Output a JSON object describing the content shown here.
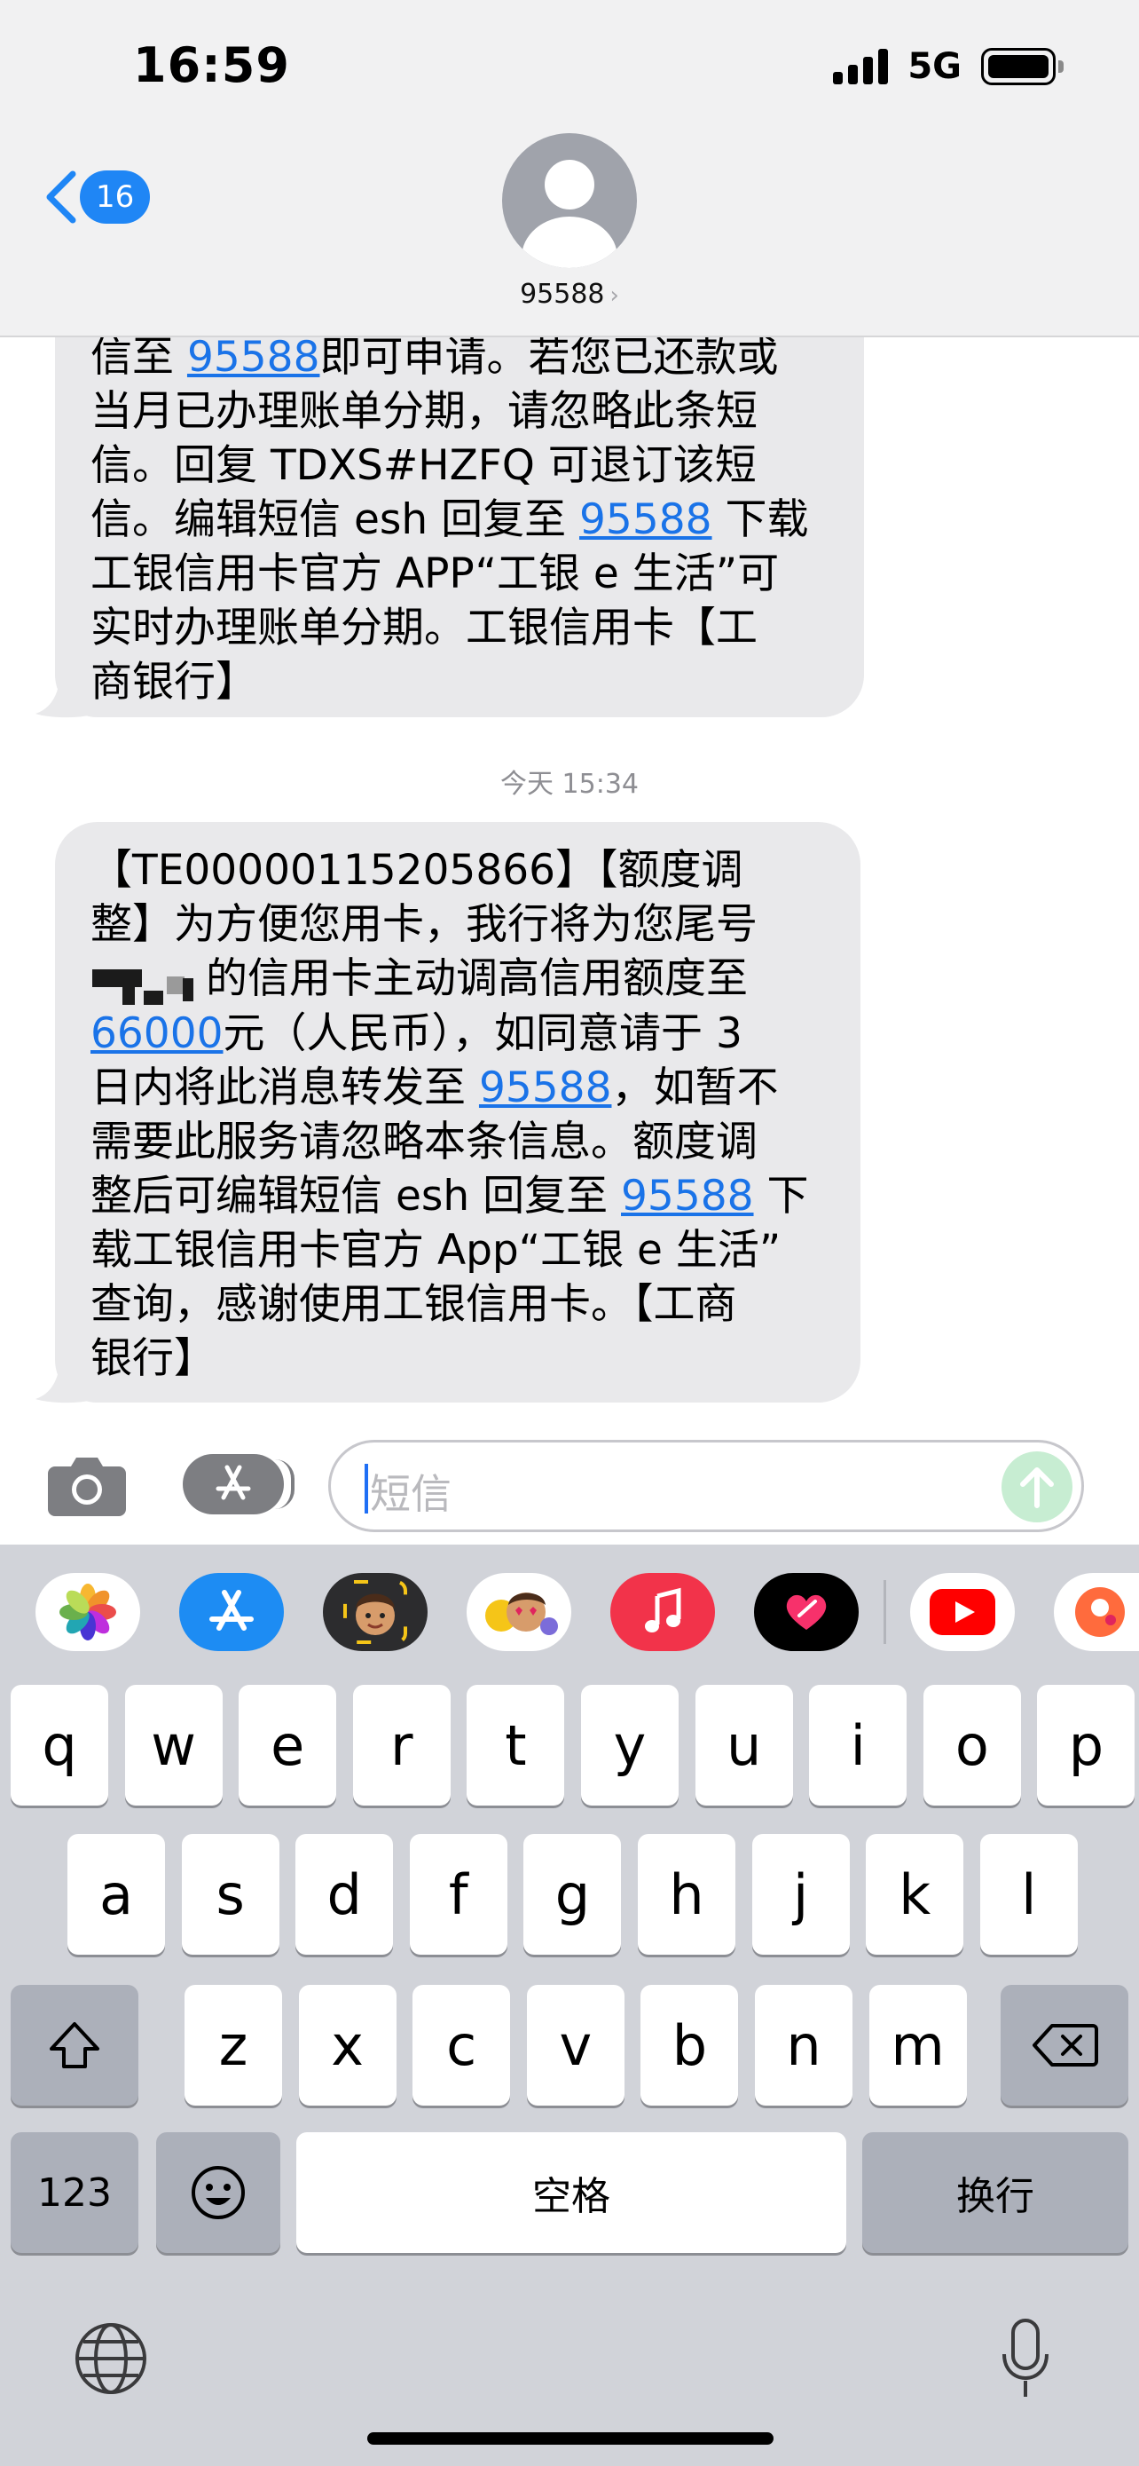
{
  "status_bar": {
    "time": "16:59",
    "network": "5G"
  },
  "header": {
    "back_count": "16",
    "contact_name": "95588",
    "contact_chevron": "›"
  },
  "messages": [
    {
      "lines": [
        {
          "segments": [
            {
              "text": "信至 "
            },
            {
              "text": "95588",
              "link": true
            },
            {
              "text": "即可申请。若您已还款或"
            }
          ]
        },
        {
          "segments": [
            {
              "text": "当月已办理账单分期，请忽略此条短"
            }
          ]
        },
        {
          "segments": [
            {
              "text": "信。回复 TDXS#HZFQ 可退订该短"
            }
          ]
        },
        {
          "segments": [
            {
              "text": "信。编辑短信 esh 回复至 "
            },
            {
              "text": "95588",
              "link": true
            },
            {
              "text": " 下载"
            }
          ]
        },
        {
          "segments": [
            {
              "text": "工银信用卡官方 APP“工银 e 生活”可"
            }
          ]
        },
        {
          "segments": [
            {
              "text": "实时办理账单分期。工银信用卡【工"
            }
          ]
        },
        {
          "segments": [
            {
              "text": "商银行】"
            }
          ]
        }
      ]
    },
    {
      "lines": [
        {
          "segments": [
            {
              "text": "【TE00000115205866】【额度调"
            }
          ]
        },
        {
          "segments": [
            {
              "text": "整】为方便您用卡，我行将为您尾号"
            }
          ]
        },
        {
          "segments": [
            {
              "redacted": true
            },
            {
              "text": "的信用卡主动调高信用额度至"
            }
          ]
        },
        {
          "segments": [
            {
              "text": "66000",
              "link": true
            },
            {
              "text": "元（人民币），如同意请于 3"
            }
          ]
        },
        {
          "segments": [
            {
              "text": "日内将此消息转发至 "
            },
            {
              "text": "95588",
              "link": true
            },
            {
              "text": "，如暂不"
            }
          ]
        },
        {
          "segments": [
            {
              "text": "需要此服务请忽略本条信息。额度调"
            }
          ]
        },
        {
          "segments": [
            {
              "text": "整后可编辑短信 esh 回复至 "
            },
            {
              "text": "95588",
              "link": true
            },
            {
              "text": " 下"
            }
          ]
        },
        {
          "segments": [
            {
              "text": "载工银信用卡官方 App“工银 e 生活”"
            }
          ]
        },
        {
          "segments": [
            {
              "text": "查询，感谢使用工银信用卡。【工商"
            }
          ]
        },
        {
          "segments": [
            {
              "text": "银行】"
            }
          ]
        }
      ]
    }
  ],
  "timestamp": "今天 15:34",
  "input": {
    "placeholder": "短信"
  },
  "app_strip": [
    {
      "name": "photos-app-icon"
    },
    {
      "name": "app-store-app-icon"
    },
    {
      "name": "memoji-app-icon"
    },
    {
      "name": "animoji-stickers-app-icon"
    },
    {
      "name": "music-app-icon"
    },
    {
      "name": "digital-touch-app-icon"
    },
    {
      "name": "youtube-app-icon"
    },
    {
      "name": "partial-app-icon"
    }
  ],
  "keyboard": {
    "row1": [
      "q",
      "w",
      "e",
      "r",
      "t",
      "y",
      "u",
      "i",
      "o",
      "p"
    ],
    "row2": [
      "a",
      "s",
      "d",
      "f",
      "g",
      "h",
      "j",
      "k",
      "l"
    ],
    "row3": [
      "z",
      "x",
      "c",
      "v",
      "b",
      "n",
      "m"
    ],
    "numbers_label": "123",
    "space_label": "空格",
    "return_label": "换行"
  },
  "colors": {
    "link": "#1a73e8",
    "badge": "#1f86f5",
    "bubble": "#e9e9eb",
    "keyboard_bg": "#d1d3d9",
    "send_button": "#c7edd2"
  }
}
